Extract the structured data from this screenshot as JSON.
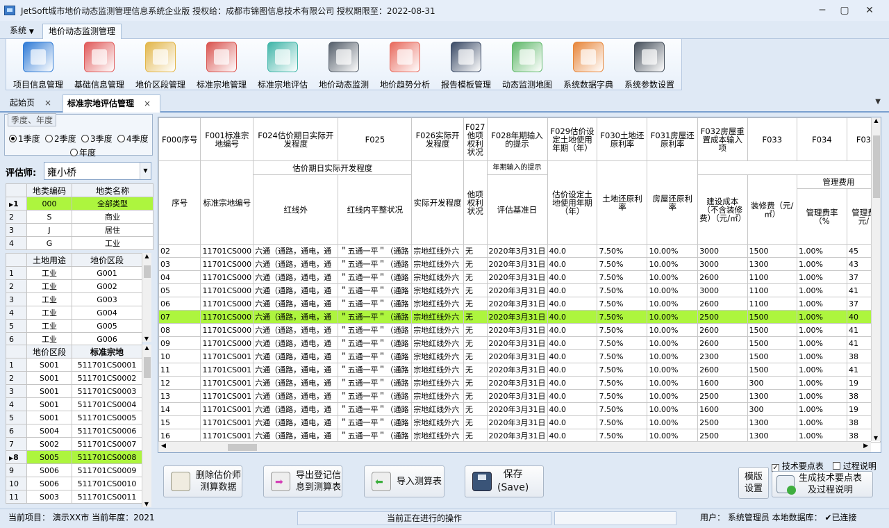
{
  "window": {
    "title": "JetSoft城市地价动态监测管理信息系统企业版   授权给：成都市锦图信息技术有限公司   授权期限至：2022-08-31"
  },
  "menu": {
    "system": "系统",
    "active_tab": "地价动态监测管理"
  },
  "ribbon": [
    {
      "label": "项目信息管理",
      "icon": "globe-computer-icon",
      "color": "#2f7bd6"
    },
    {
      "label": "基础信息管理",
      "icon": "clipboard-icon",
      "color": "#e05a5a"
    },
    {
      "label": "地价区段管理",
      "icon": "map-segment-icon",
      "color": "#e2b64a"
    },
    {
      "label": "标准宗地管理",
      "icon": "map-pin-icon",
      "color": "#d9534f"
    },
    {
      "label": "标准宗地评估",
      "icon": "house-evaluate-icon",
      "color": "#3fb5a8"
    },
    {
      "label": "地价动态监测",
      "icon": "monitor-chart-icon",
      "color": "#555f6b"
    },
    {
      "label": "地价趋势分析",
      "icon": "trend-chart-icon",
      "color": "#e86a5d"
    },
    {
      "label": "报告模板管理",
      "icon": "laptop-icon",
      "color": "#3a4a66"
    },
    {
      "label": "动态监测地图",
      "icon": "map-search-icon",
      "color": "#5fb86a"
    },
    {
      "label": "系统数据字典",
      "icon": "dictionary-icon",
      "color": "#e7863a"
    },
    {
      "label": "系统参数设置",
      "icon": "settings-gears-icon",
      "color": "#46505c"
    }
  ],
  "doc_tabs": [
    {
      "label": "起始页"
    },
    {
      "label": "标准宗地评估管理"
    }
  ],
  "season": {
    "group_title": "季度、年度",
    "options": [
      "1季度",
      "2季度",
      "3季度",
      "4季度",
      "年度"
    ],
    "selected": "1季度"
  },
  "evaluator": {
    "label": "评估师:",
    "value": "雍小桥"
  },
  "land_class": {
    "headers": [
      "地类编码",
      "地类名称"
    ],
    "rows": [
      {
        "n": "1",
        "code": "000",
        "name": "全部类型"
      },
      {
        "n": "2",
        "code": "S",
        "name": "商业"
      },
      {
        "n": "3",
        "code": "J",
        "name": "居住"
      },
      {
        "n": "4",
        "code": "G",
        "name": "工业"
      }
    ],
    "selected_row": "1"
  },
  "land_use": {
    "headers": [
      "土地用途",
      "地价区段"
    ],
    "rows": [
      {
        "n": "1",
        "use": "工业",
        "seg": "G001"
      },
      {
        "n": "2",
        "use": "工业",
        "seg": "G002"
      },
      {
        "n": "3",
        "use": "工业",
        "seg": "G003"
      },
      {
        "n": "4",
        "use": "工业",
        "seg": "G004"
      },
      {
        "n": "5",
        "use": "工业",
        "seg": "G005"
      },
      {
        "n": "6",
        "use": "工业",
        "seg": "G006"
      }
    ]
  },
  "parcels": {
    "headers": [
      "地价区段",
      "标准宗地"
    ],
    "rows": [
      {
        "n": "1",
        "seg": "S001",
        "parcel": "511701CS0001"
      },
      {
        "n": "2",
        "seg": "S001",
        "parcel": "511701CS0002"
      },
      {
        "n": "3",
        "seg": "S001",
        "parcel": "511701CS0003"
      },
      {
        "n": "4",
        "seg": "S001",
        "parcel": "511701CS0004"
      },
      {
        "n": "5",
        "seg": "S001",
        "parcel": "511701CS0005"
      },
      {
        "n": "6",
        "seg": "S004",
        "parcel": "511701CS0006"
      },
      {
        "n": "7",
        "seg": "S002",
        "parcel": "511701CS0007"
      },
      {
        "n": "8",
        "seg": "S005",
        "parcel": "511701CS0008"
      },
      {
        "n": "9",
        "seg": "S006",
        "parcel": "511701CS0009"
      },
      {
        "n": "10",
        "seg": "S006",
        "parcel": "511701CS0010"
      },
      {
        "n": "11",
        "seg": "S003",
        "parcel": "511701CS0011"
      }
    ],
    "selected_row": "8"
  },
  "grid": {
    "codes": [
      "F000序号",
      "F001标准宗地编号",
      "F024估价期日实际开发程度",
      "F025",
      "F026实际开发程度",
      "F027他项权利状况",
      "F028年期输入的提示",
      "F029估价设定土地使用年期（年）",
      "F030土地还原利率",
      "F031房屋还原利率",
      "F032房屋重置成本输入项",
      "F033",
      "F034",
      "F03"
    ],
    "names": [
      "序号",
      "标准宗地编号",
      "红线外",
      "红线内平整状况",
      "实际开发程度",
      "他项权利状况",
      "评估基准日",
      "估价设定土地使用年期（年）",
      "土地还原利率",
      "房屋还原利率",
      "建设成本（不含装修费）（元/㎡）",
      "装修费（元/㎡）",
      "管理费率（%",
      "管理费元/"
    ],
    "group_f024": "估价期日实际开发程度",
    "group_f028": "年期输入的提示",
    "group_mgmt": "管理费用",
    "rows": [
      [
        "02",
        "11701CS000",
        "六通（通路，通电，通",
        "＂五通一平＂（通路",
        "宗地红线外六",
        "无",
        "2020年3月31日",
        "40.0",
        "7.50%",
        "10.00%",
        "3000",
        "1500",
        "1.00%",
        "45"
      ],
      [
        "03",
        "11701CS000",
        "六通（通路，通电，通",
        "＂五通一平＂（通路",
        "宗地红线外六",
        "无",
        "2020年3月31日",
        "40.0",
        "7.50%",
        "10.00%",
        "3000",
        "1300",
        "1.00%",
        "43"
      ],
      [
        "04",
        "11701CS000",
        "六通（通路，通电，通",
        "＂五通一平＂（通路",
        "宗地红线外六",
        "无",
        "2020年3月31日",
        "40.0",
        "7.50%",
        "10.00%",
        "2600",
        "1100",
        "1.00%",
        "37"
      ],
      [
        "05",
        "11701CS000",
        "六通（通路，通电，通",
        "＂五通一平＂（通路",
        "宗地红线外六",
        "无",
        "2020年3月31日",
        "40.0",
        "7.50%",
        "10.00%",
        "3000",
        "1100",
        "1.00%",
        "41"
      ],
      [
        "06",
        "11701CS000",
        "六通（通路，通电，通",
        "＂五通一平＂（通路",
        "宗地红线外六",
        "无",
        "2020年3月31日",
        "40.0",
        "7.50%",
        "10.00%",
        "2600",
        "1100",
        "1.00%",
        "37"
      ],
      [
        "07",
        "11701CS000",
        "六通（通路，通电，通",
        "＂五通一平＂（通路",
        "宗地红线外六",
        "无",
        "2020年3月31日",
        "40.0",
        "7.50%",
        "10.00%",
        "2500",
        "1500",
        "1.00%",
        "40"
      ],
      [
        "08",
        "11701CS000",
        "六通（通路，通电，通",
        "＂五通一平＂（通路",
        "宗地红线外六",
        "无",
        "2020年3月31日",
        "40.0",
        "7.50%",
        "10.00%",
        "2600",
        "1500",
        "1.00%",
        "41"
      ],
      [
        "09",
        "11701CS000",
        "六通（通路，通电，通",
        "＂五通一平＂（通路",
        "宗地红线外六",
        "无",
        "2020年3月31日",
        "40.0",
        "7.50%",
        "10.00%",
        "2600",
        "1500",
        "1.00%",
        "41"
      ],
      [
        "10",
        "11701CS001",
        "六通（通路，通电，通",
        "＂五通一平＂（通路",
        "宗地红线外六",
        "无",
        "2020年3月31日",
        "40.0",
        "7.50%",
        "10.00%",
        "2300",
        "1500",
        "1.00%",
        "38"
      ],
      [
        "11",
        "11701CS001",
        "六通（通路，通电，通",
        "＂五通一平＂（通路",
        "宗地红线外六",
        "无",
        "2020年3月31日",
        "40.0",
        "7.50%",
        "10.00%",
        "2600",
        "1500",
        "1.00%",
        "41"
      ],
      [
        "12",
        "11701CS001",
        "六通（通路，通电，通",
        "＂五通一平＂（通路",
        "宗地红线外六",
        "无",
        "2020年3月31日",
        "40.0",
        "7.50%",
        "10.00%",
        "1600",
        "300",
        "1.00%",
        "19"
      ],
      [
        "13",
        "11701CS001",
        "六通（通路，通电，通",
        "＂五通一平＂（通路",
        "宗地红线外六",
        "无",
        "2020年3月31日",
        "40.0",
        "7.50%",
        "10.00%",
        "2500",
        "1300",
        "1.00%",
        "38"
      ],
      [
        "14",
        "11701CS001",
        "六通（通路，通电，通",
        "＂五通一平＂（通路",
        "宗地红线外六",
        "无",
        "2020年3月31日",
        "40.0",
        "7.50%",
        "10.00%",
        "1600",
        "300",
        "1.00%",
        "19"
      ],
      [
        "15",
        "11701CS001",
        "六通（通路，通电，通",
        "＂五通一平＂（通路",
        "宗地红线外六",
        "无",
        "2020年3月31日",
        "40.0",
        "7.50%",
        "10.00%",
        "2500",
        "1300",
        "1.00%",
        "38"
      ],
      [
        "16",
        "11701CS001",
        "六通（通路，通电，通",
        "＂五通一平＂（通路",
        "宗地红线外六",
        "无",
        "2020年3月31日",
        "40.0",
        "7.50%",
        "10.00%",
        "2500",
        "1300",
        "1.00%",
        "38"
      ]
    ],
    "selected_row": "07"
  },
  "actions": {
    "delete": "删除估价师\n测算数据",
    "export": "导出登记信\n息到测算表",
    "import": "导入测算表",
    "save": "保存\n(Save)",
    "template": "模版\n设置",
    "generate": "生成技术要点表\n及过程说明",
    "chk_tech": "技术要点表",
    "chk_process": "过程说明",
    "chk_tech_checked": true,
    "chk_process_checked": false
  },
  "status": {
    "project": "当前项目：  演示XX市    当前年度：2021",
    "operation": "当前正在进行的操作",
    "user": "用户：  系统管理员   本地数据库：  ✔已连接"
  },
  "colors": {
    "select": "#adf53e",
    "accent": "#7aa0cf"
  }
}
